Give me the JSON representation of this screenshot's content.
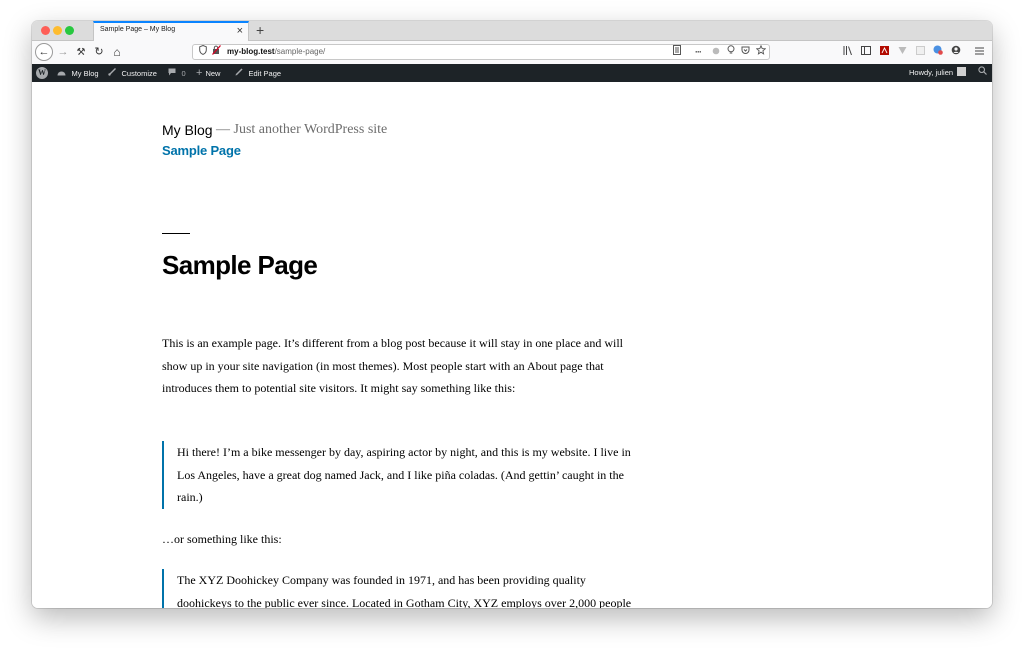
{
  "browser": {
    "tab": {
      "title": "Sample Page – My Blog",
      "close_glyph": "×"
    },
    "new_tab_glyph": "+",
    "nav": {
      "back_glyph": "←",
      "forward_glyph": "→",
      "tools_glyph": "⚒",
      "reload_glyph": "↻",
      "home_glyph": "⌂"
    },
    "url": {
      "domain": "my-blog.test",
      "path": "/sample-page/"
    },
    "url_icons": [
      "shield-icon",
      "insecure-lock-icon",
      "reader-view-icon",
      "page-actions-icon",
      "extension-icon",
      "lightbulb-icon",
      "pocket-icon",
      "bookmark-star-icon"
    ],
    "toolbar_icons": [
      "library-icon",
      "sidebar-icon",
      "pdf-extension-icon",
      "vpn-extension-icon",
      "blank-extension-icon",
      "translate-extension-icon",
      "account-icon",
      "menu-icon"
    ]
  },
  "adminbar": {
    "wp_logo_glyph": "W",
    "site_name": "My Blog",
    "customize": "Customize",
    "comments_count": "0",
    "new_label": "New",
    "edit_label": "Edit Page",
    "greeting": "Howdy, julien",
    "colors": {
      "background": "#1d2327",
      "text": "#f0f0f1",
      "icon": "#a7aaad"
    }
  },
  "site": {
    "title": "My Blog",
    "tagline": "— Just another WordPress site",
    "nav_link": "Sample Page",
    "link_color": "#0073aa"
  },
  "page": {
    "title": "Sample Page",
    "intro": "This is an example page. It’s different from a blog post because it will stay in one place and will show up in your site navigation (in most themes). Most people start with an About page that introduces them to potential site visitors. It might say something like this:",
    "quote1": "Hi there! I’m a bike messenger by day, aspiring actor by night, and this is my website. I live in Los Angeles, have a great dog named Jack, and I like piña coladas. (And gettin’ caught in the rain.)",
    "middle": "…or something like this:",
    "quote2": "The XYZ Doohickey Company was founded in 1971, and has been providing quality doohickeys to the public ever since. Located in Gotham City, XYZ employs over 2,000 people and does all kinds of awesome things for the Gotham community."
  }
}
